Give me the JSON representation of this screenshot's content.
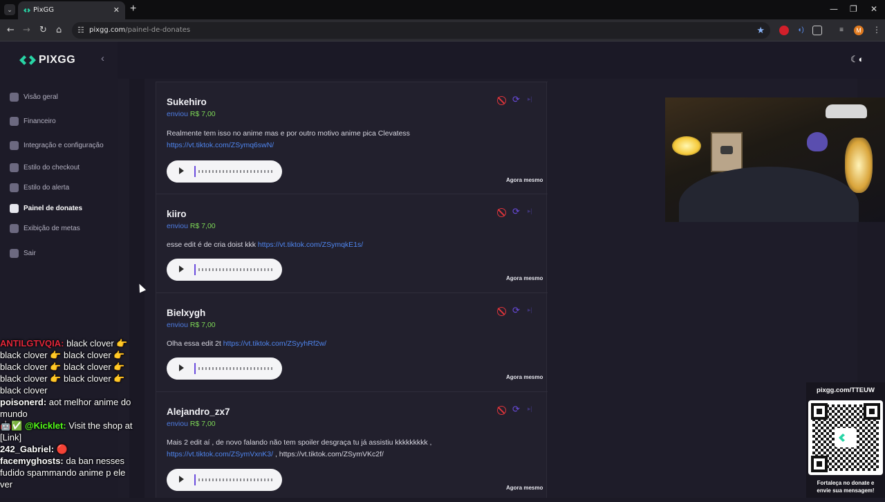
{
  "browser": {
    "tab_title": "PixGG",
    "url_domain": "pixgg.com",
    "url_path": "/painel-de-donates",
    "profile_initial": "M",
    "window_min": "—",
    "window_max": "❐",
    "window_close": "✕"
  },
  "sidebar": {
    "brand": "PIXGG",
    "items": [
      {
        "label": "Visão geral",
        "icon": "home-icon"
      },
      {
        "label": "Financeiro",
        "icon": "wallet-icon"
      },
      {
        "label": "Integração e configuração",
        "icon": "integration-icon"
      },
      {
        "label": "Estilo do checkout",
        "icon": "palette-icon"
      },
      {
        "label": "Estilo do alerta",
        "icon": "palette-icon"
      },
      {
        "label": "Painel de donates",
        "icon": "donate-icon",
        "active": true
      },
      {
        "label": "Exibição de metas",
        "icon": "star-icon"
      },
      {
        "label": "Sair",
        "icon": "logout-icon"
      }
    ]
  },
  "donates": [
    {
      "name": "Sukehiro",
      "sent_label": "enviou",
      "amount": "R$ 7,00",
      "message_text": "Realmente tem isso no anime mas e por outro motivo anime pica Clevatess",
      "links": [
        "https://vt.tiktok.com/ZSymq6swN/"
      ],
      "time": "Agora mesmo"
    },
    {
      "name": "kiiro",
      "sent_label": "enviou",
      "amount": "R$ 7,00",
      "message_text": "esse edit é de cria doist kkk",
      "links": [
        "https://vt.tiktok.com/ZSymqkE1s/"
      ],
      "time": "Agora mesmo"
    },
    {
      "name": "Bielxygh",
      "sent_label": "enviou",
      "amount": "R$ 7,00",
      "message_text": "Olha essa edit 2t",
      "links": [
        "https://vt.tiktok.com/ZSyyhRf2w/"
      ],
      "time": "Agora mesmo"
    },
    {
      "name": "Alejandro_zx7",
      "sent_label": "enviou",
      "amount": "R$ 7,00",
      "message_text": "Mais 2 edit aí , de novo falando não tem spoiler desgraça tu já assistiu kkkkkkkkk ,",
      "links": [
        "https://vt.tiktok.com/ZSymVxnK3/",
        ", https://vt.tiktok.com/ZSymVKc2f/"
      ],
      "time": "Agora mesmo"
    }
  ],
  "chat": [
    {
      "user": "ANTILGTVQIA:",
      "color": "#e3263a",
      "text": "black clover 👉 black clover 👉 black clover 👉 black clover 👉 black clover 👉 black clover 👉 black clover 👉 black clover"
    },
    {
      "user": "poisonerd:",
      "color": "#ffffff",
      "text": "aot melhor anime do mundo"
    },
    {
      "user": "🤖✅ @Kicklet:",
      "color": "#53fc18",
      "text": "Visit the shop at [Link]"
    },
    {
      "user": "242_Gabriel:",
      "color": "#ffffff",
      "text": "🔴"
    },
    {
      "user": "facemyghosts:",
      "color": "#ffffff",
      "text": "da ban nesses fudido spammando anime p ele ver"
    }
  ],
  "qr_panel": {
    "url": "pixgg.com/TTEUW",
    "cta_line1": "Fortaleça no donate e",
    "cta_line2": "envie sua mensagem!"
  },
  "colors": {
    "accent_blue": "#4f7de3",
    "amount_green": "#7ed957",
    "ban_red": "#e0353b",
    "replay_purple": "#6a4bde"
  }
}
